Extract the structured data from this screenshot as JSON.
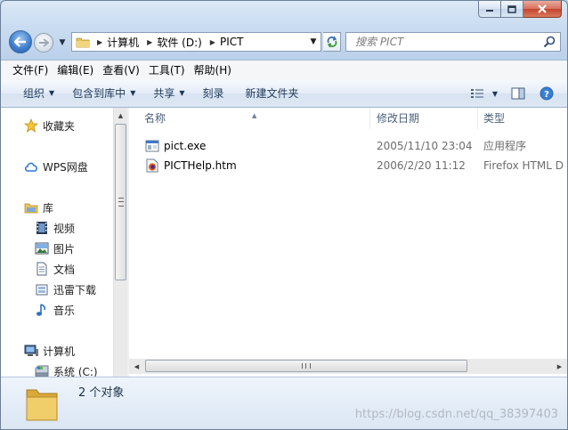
{
  "window": {
    "buttons": {
      "minimize": "minimize",
      "maximize": "maximize",
      "close": "close"
    }
  },
  "nav": {
    "breadcrumbs": [
      "计算机",
      "软件 (D:)",
      "PICT"
    ],
    "search_placeholder": "搜索 PICT"
  },
  "menu": [
    "文件(F)",
    "编辑(E)",
    "查看(V)",
    "工具(T)",
    "帮助(H)"
  ],
  "commands": {
    "organize": "组织",
    "include_library": "包含到库中",
    "share": "共享",
    "burn": "刻录",
    "new_folder": "新建文件夹"
  },
  "sidebar": {
    "favorites": "收藏夹",
    "wps": "WPS网盘",
    "library": "库",
    "library_items": [
      "视频",
      "图片",
      "文档",
      "迅雷下载",
      "音乐"
    ],
    "computer": "计算机",
    "drive": "系统 (C:)"
  },
  "columns": {
    "name": "名称",
    "date": "修改日期",
    "type": "类型"
  },
  "files": [
    {
      "name": "pict.exe",
      "date": "2005/11/10 23:04",
      "type": "应用程序",
      "icon": "exe-icon"
    },
    {
      "name": "PICTHelp.htm",
      "date": "2006/2/20 11:12",
      "type": "Firefox HTML D",
      "icon": "firefox-html-icon"
    }
  ],
  "status": {
    "count": "2 个对象"
  },
  "watermark": "https://blog.csdn.net/qq_38397403",
  "colors": {
    "accent": "#3d7bc9",
    "folder": "#e8c35a",
    "close": "#c4452c"
  }
}
